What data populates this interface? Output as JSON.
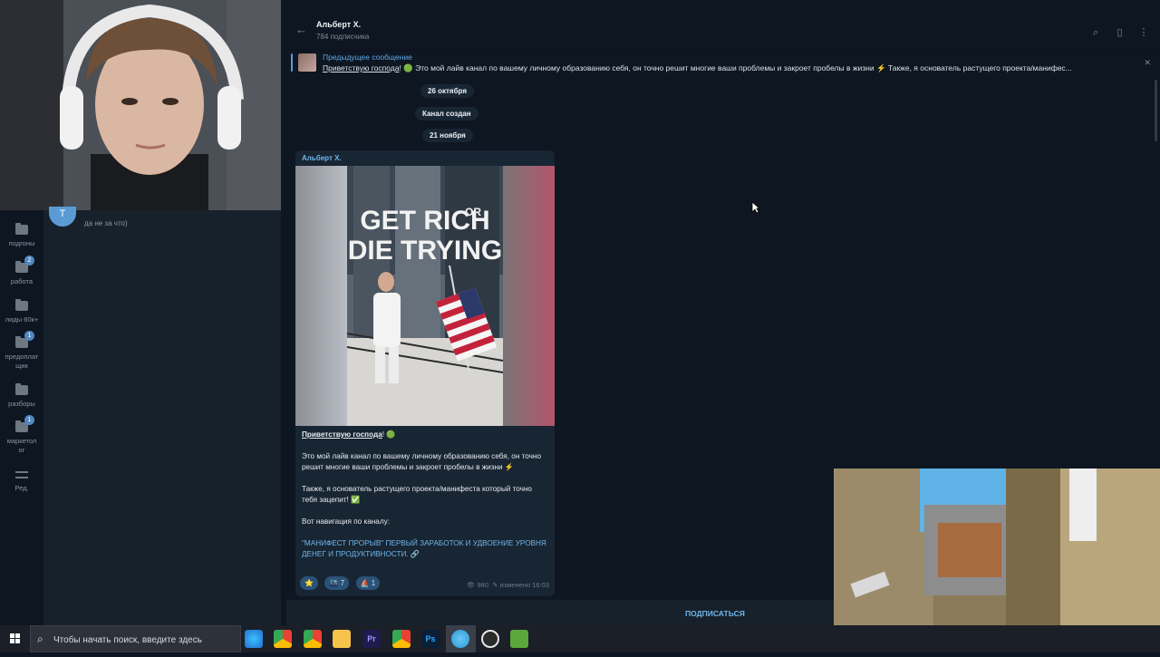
{
  "channel": {
    "name": "Альберт Х.",
    "subscribers": "784 подписчика"
  },
  "pinned": {
    "title": "Предыдущее сообщение",
    "greeting": "Приветствую господа",
    "text": "! 🟢 Это мой лайв канал по вашему личному образованию себя, он точно решит многие ваши проблемы и закроет пробелы в жизни ⚡ Также, я основатель растущего проекта/манифес..."
  },
  "dates": {
    "date1": "26 октября",
    "service": "Канал создан",
    "date2": "21 ноября"
  },
  "post": {
    "author": "Альберт Х.",
    "image_caption": "GET RICH OR DIE TRYING",
    "greeting": "Приветствую господа",
    "greeting_tail": "! 🟢",
    "para1": "Это мой лайв канал по вашему личному образованию себя, он точно решит многие ваши проблемы и закроет пробелы в жизни ⚡",
    "para2": "Также, я основатель растущего проекта/манифеста который точно тебя зацепит! ✅",
    "para3": "Вот навигация по каналу:",
    "link": "\"МАНИФЕСТ ПРОРЫВ\" ПЕРВЫЙ ЗАРАБОТОК И УДВОЕНИЕ УРОВНЯ ДЕНЕГ И ПРОДУКТИВНОСТИ. 🔗",
    "reactions": [
      {
        "emoji": "⭐",
        "count": ""
      },
      {
        "emoji": "🌃",
        "count": "7"
      },
      {
        "emoji": "⛵",
        "count": "1"
      }
    ],
    "views": "980",
    "edited": "изменено 16:03"
  },
  "subscribe_label": "ПОДПИСАТЬСЯ",
  "folders": [
    {
      "label": "подгоны",
      "badge": ""
    },
    {
      "label": "работа",
      "badge": "2"
    },
    {
      "label": "лиды 60к+",
      "badge": ""
    },
    {
      "label": "предоплат щик",
      "badge": "1"
    },
    {
      "label": "разборы",
      "badge": ""
    },
    {
      "label": "маркетол ог",
      "badge": "1"
    }
  ],
  "edit_label": "Ред.",
  "chat_preview": {
    "avatar_letter": "T",
    "preview": "да не за что)"
  },
  "taskbar": {
    "search_placeholder": "Чтобы начать поиск, введите здесь"
  },
  "colors": {
    "accent": "#5fa8e8",
    "background": "#0e1621",
    "bubble": "#182533",
    "sidebar": "#17212b"
  }
}
